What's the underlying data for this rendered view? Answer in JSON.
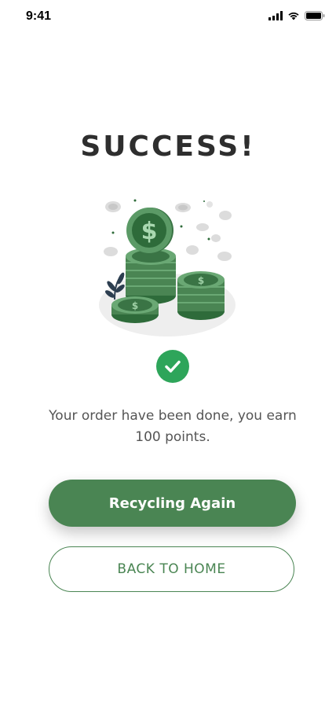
{
  "status": {
    "time": "9:41"
  },
  "title": "SUCCESS!",
  "message": "Your order have been done, you earn 100 points.",
  "buttons": {
    "primary_label": "Recycling Again",
    "secondary_label": "BACK TO HOME"
  },
  "colors": {
    "brand_green": "#4a8553",
    "check_green": "#2ea55a",
    "title": "#2e2e2e",
    "text": "#555555"
  }
}
